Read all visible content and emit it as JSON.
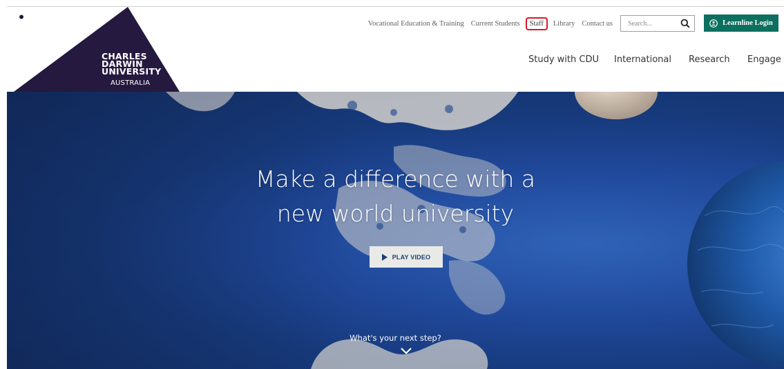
{
  "colors": {
    "brand_navy": "#25193f",
    "login_green": "#0c6f5f",
    "highlight_red": "#d11a2a",
    "hero_blue": "#20489a"
  },
  "logo": {
    "line1": "CHARLES",
    "line2": "DARWIN",
    "line3": "UNIVERSITY",
    "sub": "AUSTRALIA"
  },
  "utility_nav": {
    "items": [
      {
        "label": "Vocational Education & Training"
      },
      {
        "label": "Current Students"
      },
      {
        "label": "Staff"
      },
      {
        "label": "Library"
      },
      {
        "label": "Contact us"
      }
    ]
  },
  "search": {
    "placeholder": "Search...",
    "icon": "search-icon"
  },
  "login": {
    "label": "Learnline Login",
    "icon": "user-circle-icon"
  },
  "main_nav": {
    "items": [
      {
        "label": "Study with CDU"
      },
      {
        "label": "International"
      },
      {
        "label": "Research"
      },
      {
        "label": "Engage"
      }
    ]
  },
  "hero": {
    "title_line1": "Make a difference with a",
    "title_line2": "new world university",
    "play_label": "PLAY VIDEO",
    "next_step": "What's your next step?",
    "chevron_icon": "chevron-down-icon"
  }
}
